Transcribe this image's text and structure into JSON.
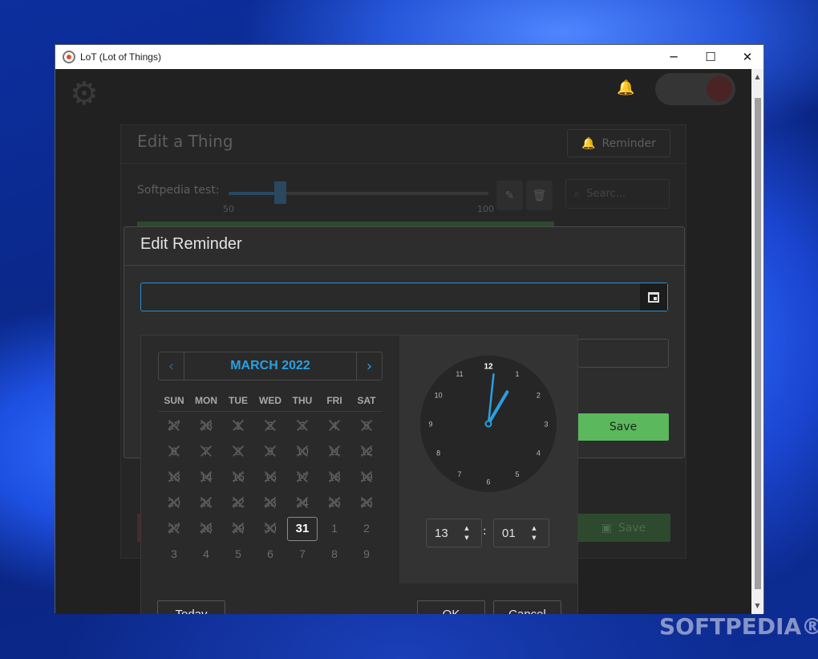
{
  "window": {
    "title": "LoT (Lot of Things)",
    "minimize": "─",
    "maximize": "☐",
    "close": "✕"
  },
  "background": {
    "card_title": "Edit a Thing",
    "reminder_button": "Reminder",
    "item_label": "Softpedia test:",
    "slider": {
      "min_label": "50",
      "max_label": "100",
      "value_fraction": 0.2
    },
    "search_placeholder": "Searc...",
    "save_label": "Save"
  },
  "dialog": {
    "title": "Edit Reminder",
    "date_value": "",
    "save_label": "Save"
  },
  "calendar": {
    "month_label": "MARCH 2022",
    "prev_icon": "‹",
    "next_icon": "›",
    "weekdays": [
      "SUN",
      "MON",
      "TUE",
      "WED",
      "THU",
      "FRI",
      "SAT"
    ],
    "weeks": [
      [
        "27",
        "28",
        "1",
        "2",
        "3",
        "4",
        "5"
      ],
      [
        "6",
        "7",
        "8",
        "9",
        "10",
        "11",
        "12"
      ],
      [
        "13",
        "14",
        "15",
        "16",
        "17",
        "18",
        "19"
      ],
      [
        "20",
        "21",
        "22",
        "23",
        "24",
        "25",
        "26"
      ],
      [
        "27",
        "28",
        "29",
        "30",
        "31",
        "1",
        "2"
      ],
      [
        "3",
        "4",
        "5",
        "6",
        "7",
        "8",
        "9"
      ]
    ],
    "selected_day": "31"
  },
  "clock": {
    "numbers": [
      "12",
      "1",
      "2",
      "3",
      "4",
      "5",
      "6",
      "7",
      "8",
      "9",
      "10",
      "11"
    ],
    "hour": "13",
    "minute": "01",
    "colon": ":",
    "hand_color": "#2aa0e0"
  },
  "buttons": {
    "today": "Today",
    "ok": "OK",
    "cancel": "Cancel"
  },
  "watermark": "SOFTPEDIA®",
  "colors": {
    "accent": "#2aa0e0",
    "save_green": "#5cb85c"
  }
}
